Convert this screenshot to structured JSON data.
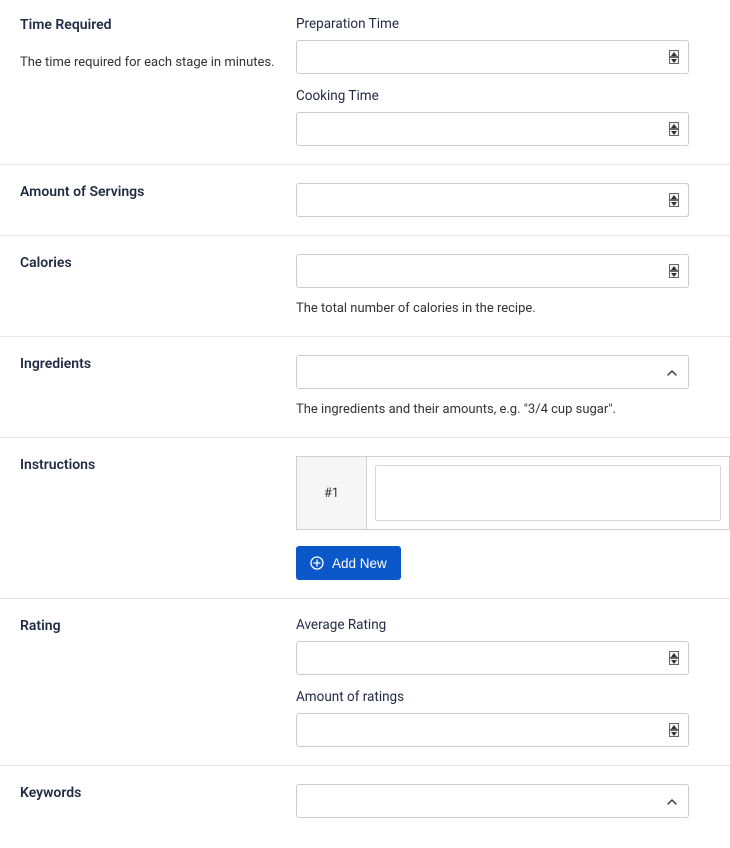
{
  "sections": {
    "time": {
      "heading": "Time Required",
      "description": "The time required for each stage in minutes.",
      "prep_label": "Preparation Time",
      "cook_label": "Cooking Time"
    },
    "servings": {
      "heading": "Amount of Servings"
    },
    "calories": {
      "heading": "Calories",
      "helper": "The total number of calories in the recipe."
    },
    "ingredients": {
      "heading": "Ingredients",
      "helper": "The ingredients and their amounts, e.g. \"3/4 cup sugar\"."
    },
    "instructions": {
      "heading": "Instructions",
      "row_label": "#1",
      "add_label": "Add New"
    },
    "rating": {
      "heading": "Rating",
      "avg_label": "Average Rating",
      "count_label": "Amount of ratings"
    },
    "keywords": {
      "heading": "Keywords"
    }
  }
}
